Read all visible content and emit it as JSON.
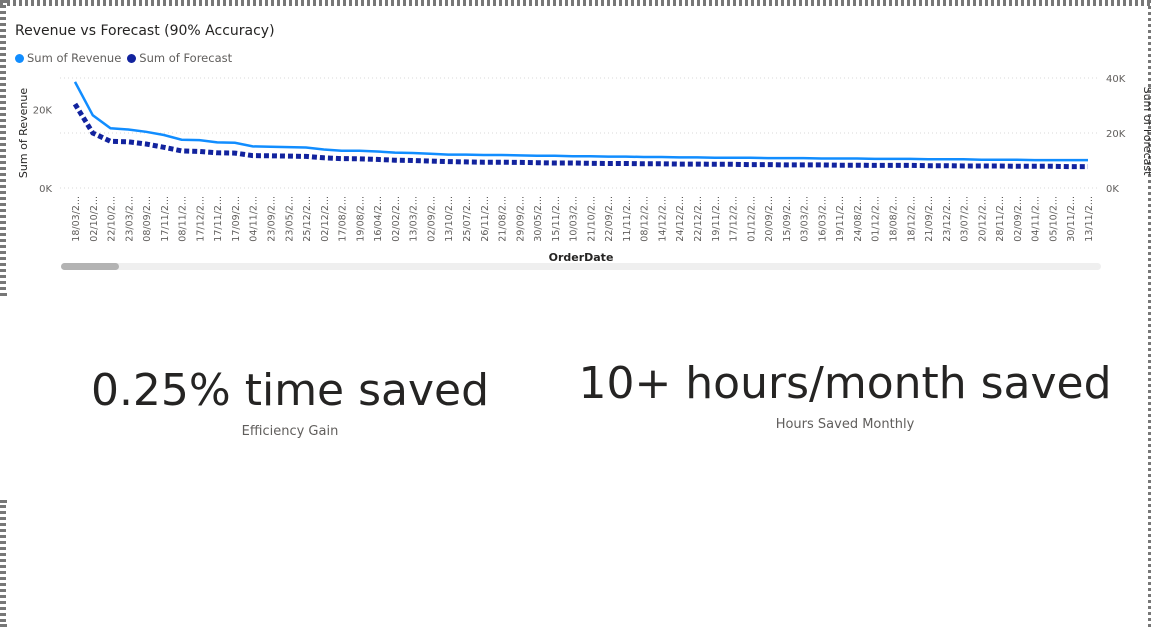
{
  "chart_data": {
    "type": "line",
    "title": "Revenue vs Forecast (90% Accuracy)",
    "xlabel": "OrderDate",
    "ylabel": "Sum of Revenue",
    "y2label": "Sum of Forecast",
    "ylim": [
      0,
      28000
    ],
    "y2lim": [
      0,
      40000
    ],
    "yticks": [
      "0K",
      "20K"
    ],
    "y2ticks": [
      "0K",
      "20K",
      "40K"
    ],
    "legend_position": "top-left",
    "x": [
      "18/03/2...",
      "02/10/2...",
      "22/10/2...",
      "23/03/2...",
      "08/09/2...",
      "17/11/2...",
      "08/11/2...",
      "17/12/2...",
      "17/11/2...",
      "17/09/2...",
      "04/11/2...",
      "23/09/2...",
      "23/05/2...",
      "25/12/2...",
      "02/12/2...",
      "17/08/2...",
      "19/08/2...",
      "16/04/2...",
      "02/02/2...",
      "13/03/2...",
      "02/09/2...",
      "13/10/2...",
      "25/07/2...",
      "26/11/2...",
      "21/08/2...",
      "29/09/2...",
      "30/05/2...",
      "15/11/2...",
      "10/03/2...",
      "21/10/2...",
      "22/09/2...",
      "11/11/2...",
      "08/12/2...",
      "14/12/2...",
      "24/12/2...",
      "22/12/2...",
      "19/11/2...",
      "17/12/2...",
      "01/12/2...",
      "20/09/2...",
      "15/09/2...",
      "03/03/2...",
      "16/03/2...",
      "19/11/2...",
      "24/08/2...",
      "01/12/2...",
      "18/08/2...",
      "18/12/2...",
      "21/09/2...",
      "23/12/2...",
      "03/07/2...",
      "20/12/2...",
      "28/11/2...",
      "02/09/2...",
      "04/11/2...",
      "05/10/2...",
      "30/11/2...",
      "13/11/2..."
    ],
    "series": [
      {
        "name": "Sum of Revenue",
        "axis": "left",
        "color": "#118dff",
        "style": "solid",
        "values": [
          27000,
          18500,
          15200,
          14900,
          14300,
          13500,
          12300,
          12200,
          11600,
          11500,
          10600,
          10500,
          10400,
          10300,
          9800,
          9500,
          9500,
          9300,
          9000,
          8900,
          8700,
          8500,
          8500,
          8400,
          8400,
          8300,
          8200,
          8200,
          8100,
          8100,
          8000,
          8000,
          7900,
          7900,
          7800,
          7800,
          7700,
          7700,
          7700,
          7600,
          7600,
          7600,
          7500,
          7500,
          7500,
          7400,
          7400,
          7400,
          7300,
          7300,
          7300,
          7200,
          7200,
          7200,
          7100,
          7100,
          7100,
          7100
        ]
      },
      {
        "name": "Sum of Forecast",
        "axis": "right",
        "color": "#12239e",
        "style": "dotted",
        "values": [
          30500,
          20000,
          17000,
          16800,
          16000,
          14800,
          13500,
          13300,
          12800,
          12700,
          11800,
          11700,
          11600,
          11500,
          11000,
          10700,
          10600,
          10400,
          10100,
          10000,
          9800,
          9600,
          9500,
          9400,
          9400,
          9300,
          9200,
          9100,
          9100,
          9000,
          8900,
          8900,
          8800,
          8800,
          8700,
          8700,
          8600,
          8600,
          8500,
          8500,
          8400,
          8400,
          8400,
          8300,
          8300,
          8200,
          8200,
          8200,
          8100,
          8100,
          8000,
          8000,
          8000,
          7900,
          7900,
          7900,
          7800,
          7800
        ]
      }
    ]
  },
  "kpis": [
    {
      "value": "0.25% time saved",
      "label": "Efficiency Gain"
    },
    {
      "value": "10+ hours/month saved",
      "label": "Hours Saved Monthly"
    }
  ]
}
